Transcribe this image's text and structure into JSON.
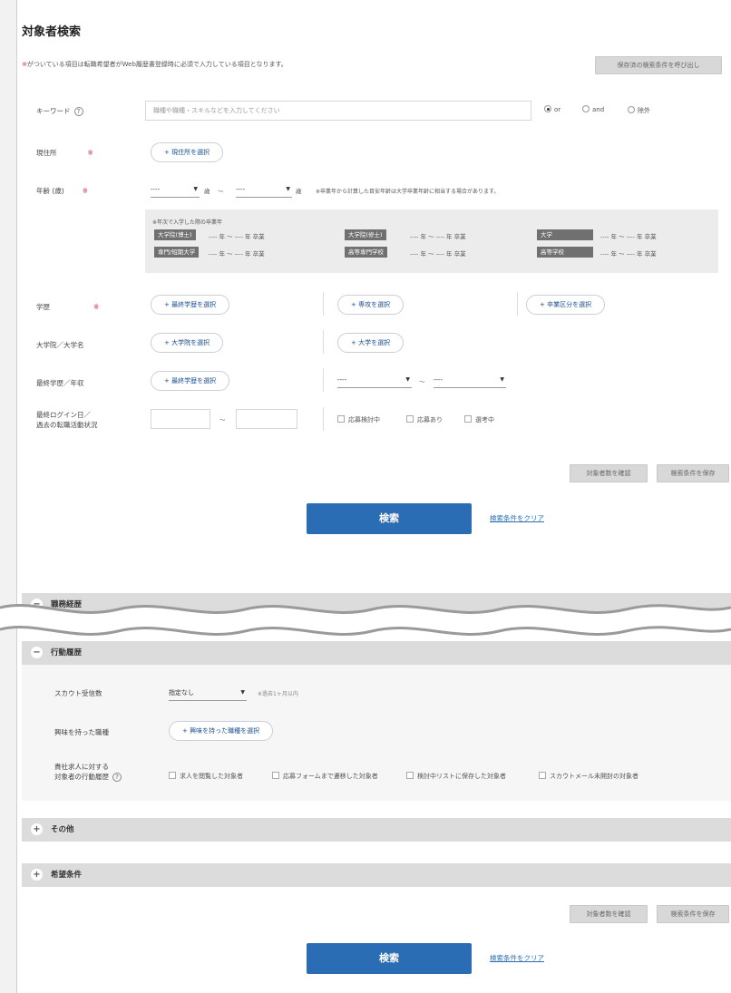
{
  "page": {
    "title": "対象者検索",
    "note_star": "※",
    "note_text": "がついている項目は転職希望者がWeb履歴書登録時に必須で入力している項目となります。",
    "save_conditions_button": "保存済の検索条件を呼び出し"
  },
  "keyword": {
    "label": "キーワード",
    "help": "?",
    "placeholder": "職種や職種・スキルなどを入力してください",
    "options": [
      "or",
      "and",
      "除外"
    ],
    "selected": "or"
  },
  "residence": {
    "label": "現住所",
    "req": "※",
    "button": "+ 現住所を選択"
  },
  "age": {
    "label": "年齢 (歳)",
    "req": "※",
    "from": "----",
    "unit1": "歳",
    "tilde": "〜",
    "to": "----",
    "unit2": "歳",
    "note": "※卒業年から計算した目安年齢は大学卒業年齢に相当する場合があります。"
  },
  "graduation": {
    "note": "※年次で入学した際の卒業年",
    "tags": [
      "大学院(博士)",
      "大学院(修士)",
      "大学",
      "専門/短期大学",
      "高等専門学校",
      "高等学校"
    ],
    "range_text": "---- 年 〜 ---- 年 卒業"
  },
  "education": {
    "label": "学歴",
    "req": "※",
    "buttons": [
      "+ 最終学歴を選択",
      "+ 専攻を選択",
      "+ 卒業区分を選択"
    ]
  },
  "school": {
    "label": "大学院／大学名",
    "buttons": [
      "+ 大学院を選択",
      "+ 大学を選択"
    ]
  },
  "region": {
    "label": "最終学歴／年収",
    "button": "+ 最終学歴を選択",
    "from": "----",
    "tilde": "〜",
    "to": "----"
  },
  "login": {
    "label_line1": "最終ログイン日／",
    "label_line2": "過去の転職活動状況",
    "tilde": "〜",
    "checks": [
      "応募検討中",
      "応募あり",
      "選考中"
    ]
  },
  "actions": {
    "confirm": "対象者数を確認",
    "save": "検索条件を保存",
    "search": "検索",
    "clear": "検索条件をクリア"
  },
  "sections": {
    "career": "職務経歴",
    "behavior": "行動履歴",
    "other": "その他",
    "desired": "希望条件"
  },
  "behavior": {
    "scout_label": "スカウト受信数",
    "scout_value": "指定なし",
    "scout_note": "※過去1ヶ月以内",
    "applied_label": "興味を持った職種",
    "applied_button": "+ 興味を持った職種を選択",
    "company_label_line1": "貴社求人に対する",
    "company_label_line2": "対象者の行動履歴",
    "help": "?",
    "checks": [
      "求人を閲覧した対象者",
      "応募フォームまで遷移した対象者",
      "検討中リストに保存した対象者",
      "スカウトメール未開封の対象者"
    ]
  }
}
